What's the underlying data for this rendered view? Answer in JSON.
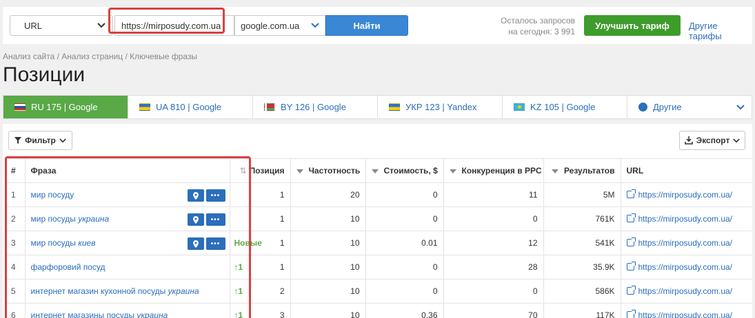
{
  "search": {
    "type_value": "URL",
    "url_value": "https://mirposudy.com.ua",
    "engine_value": "google.com.ua",
    "find_label": "Найти",
    "quota_line1": "Осталось запросов",
    "quota_line2": "на сегодня: 3 991",
    "upgrade_label": "Улучшить тариф",
    "other_plans_label": "Другие тарифы"
  },
  "breadcrumb": "Анализ сайта / Анализ страниц / Ключевые фразы",
  "page_title": "Позиции",
  "region_tabs": [
    {
      "label": "RU 175 | Google",
      "flag": "ru",
      "active": true
    },
    {
      "label": "UA 810 | Google",
      "flag": "ua",
      "active": false
    },
    {
      "label": "BY 126 | Google",
      "flag": "by",
      "active": false
    },
    {
      "label": "УКР 123 | Yandex",
      "flag": "ua",
      "active": false
    },
    {
      "label": "KZ 105 | Google",
      "flag": "kz",
      "active": false
    },
    {
      "label": "Другие",
      "flag": "globe-icon",
      "active": false
    }
  ],
  "toolbar": {
    "filter_label": "Фильтр",
    "export_label": "Экспорт"
  },
  "table": {
    "headers": {
      "num": "#",
      "phrase": "Фраза",
      "position": "Позиция",
      "frequency": "Частотность",
      "cost": "Стоимость, $",
      "competition": "Конкуренция в PPC",
      "results": "Результатов",
      "url": "URL"
    },
    "rows": [
      {
        "num": "1",
        "phrase": "мир посуду",
        "phrase_em": "",
        "change": "",
        "position": "1",
        "frequency": "20",
        "cost": "0",
        "competition": "11",
        "results": "5M",
        "url": "https://mirposudy.com.ua/",
        "actions": true
      },
      {
        "num": "2",
        "phrase": "мир посуды ",
        "phrase_em": "украина",
        "change": "",
        "position": "1",
        "frequency": "10",
        "cost": "0",
        "competition": "0",
        "results": "761K",
        "url": "https://mirposudy.com.ua/",
        "actions": true
      },
      {
        "num": "3",
        "phrase": "мир посуды ",
        "phrase_em": "киев",
        "change": "Новые",
        "position": "1",
        "frequency": "10",
        "cost": "0.01",
        "competition": "12",
        "results": "541K",
        "url": "https://mirposudy.com.ua/",
        "actions": true
      },
      {
        "num": "4",
        "phrase": "фарфоровий посуд",
        "phrase_em": "",
        "change": "↑1",
        "position": "1",
        "frequency": "10",
        "cost": "0",
        "competition": "28",
        "results": "35.9K",
        "url": "https://mirposudy.com.ua/",
        "actions": false
      },
      {
        "num": "5",
        "phrase": "интернет магазин кухонной посуды ",
        "phrase_em": "украина",
        "change": "↑1",
        "position": "2",
        "frequency": "10",
        "cost": "0",
        "competition": "0",
        "results": "586K",
        "url": "https://mirposudy.com.ua/",
        "actions": false
      },
      {
        "num": "6",
        "phrase": "интернет магазины посуды ",
        "phrase_em": "украина",
        "change": "↑1",
        "position": "3",
        "frequency": "10",
        "cost": "0.36",
        "competition": "70",
        "results": "117K",
        "url": "https://mirposudy.com.ua/",
        "actions": false
      }
    ]
  },
  "colors": {
    "accent_blue": "#3a87d6",
    "link_blue": "#2a6ebb",
    "upgrade_green": "#3e9c2c",
    "active_tab_green": "#59a946",
    "highlight_red": "#d94040"
  }
}
